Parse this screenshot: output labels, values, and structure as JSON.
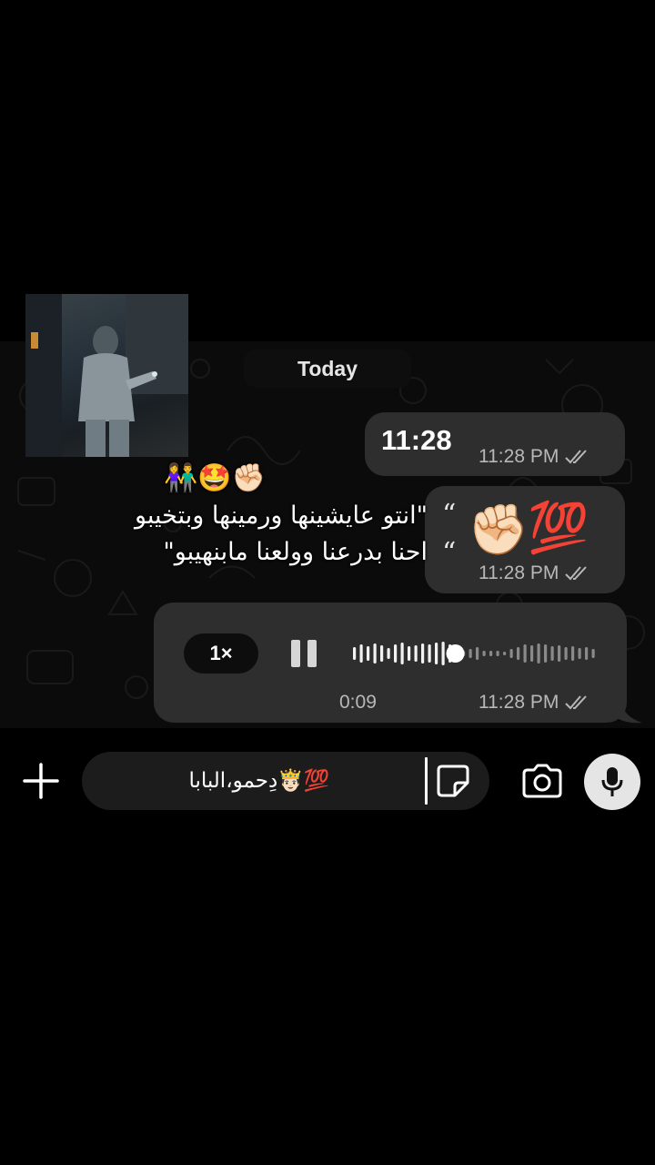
{
  "chat": {
    "date_label": "Today",
    "messages": [
      {
        "text": "11:28",
        "time": "11:28 PM",
        "status": "read"
      },
      {
        "quote_open": "“",
        "quote_close": "“",
        "emojis": [
          "✊🏻",
          "💯"
        ],
        "time": "11:28 PM",
        "status": "read"
      },
      {
        "type": "voice",
        "speed": "1×",
        "duration": "0:09",
        "time": "11:28 PM",
        "status": "read",
        "progress": 0.42
      }
    ]
  },
  "overlay": {
    "emojis": "👫🤩✊🏻",
    "line1": "\"انتو عايشينها ورمينها وبتخيبو",
    "line2": "احنا بدرعنا وولعنا مابنهيبو\""
  },
  "input": {
    "text": "دِحمو،البابا🤴🏻💯",
    "plus_icon": "plus-icon",
    "sticker_icon": "sticker-icon",
    "camera_icon": "camera-icon",
    "mic_icon": "microphone-icon"
  },
  "colors": {
    "background": "#000000",
    "bubble": "#2e2e2e",
    "meta_text": "#b8b8b8",
    "mic_button": "#e5e5e5"
  }
}
